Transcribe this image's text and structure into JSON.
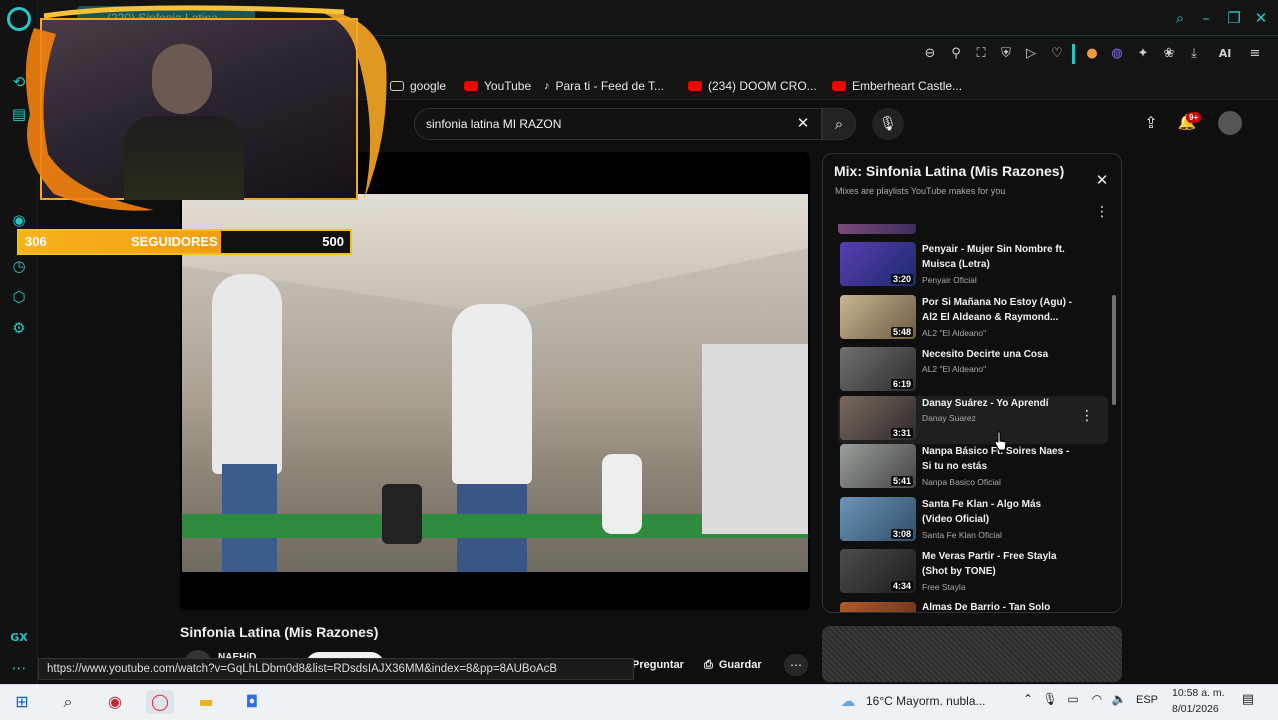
{
  "browser": {
    "active_tab": "(220) Sinfonia Latina - ...",
    "bookmarks": [
      {
        "label": "google",
        "color": "#9aa0a6"
      },
      {
        "label": "YouTube",
        "color": "#ff0000"
      },
      {
        "label": "Para ti - Feed de T...",
        "color": "#ffffff"
      },
      {
        "label": "(234) DOOM CRO...",
        "color": "#ff0000"
      },
      {
        "label": "Emberheart Castle...",
        "color": "#ff0000"
      }
    ],
    "status_url": "https://www.youtube.com/watch?v=GqLhLDbm0d8&list=RDsdsIAJX36MM&index=8&pp=8AUBoAcB",
    "toolbar_ai": "AI",
    "sidebar_bottom": "GX"
  },
  "youtube": {
    "search_query": "sinfonia latina MI RAZON",
    "notifications_badge": "9+",
    "video_title": "Sinfonia Latina (Mis Razones)",
    "channel_partial": "NAEHiD",
    "actions": {
      "ask": "Preguntar",
      "save": "Guardar"
    }
  },
  "stream_overlay": {
    "followers_current": "306",
    "followers_label": "SEGUIDORES",
    "followers_goal": "500",
    "progress_fraction": 0.61
  },
  "playlist": {
    "title": "Mix: Sinfonia Latina (Mis Razones)",
    "subtitle": "Mixes are playlists YouTube makes for you",
    "items": [
      {
        "title": "Penyair - Mujer Sin Nombre ft. Muisca (Letra)",
        "channel": "Penyair Oficial",
        "duration": "3:20"
      },
      {
        "title": "Por Si Mañana No Estoy (Agu) - Al2 El Aldeano & Raymond...",
        "channel": "AL2 \"El Aldeano\"",
        "duration": "5:48"
      },
      {
        "title": "Necesito Decirte una Cosa",
        "channel": "AL2 \"El Aldeano\"",
        "duration": "6:19"
      },
      {
        "title": "Danay Suárez - Yo Aprendí",
        "channel": "Danay Suarez",
        "duration": "3:31"
      },
      {
        "title": "Nanpa Básico Ft. Soires Naes - Si tu no estás",
        "channel": "Nanpa Basico Oficial",
        "duration": "5:41"
      },
      {
        "title": "Santa Fe Klan - Algo Más (Video Oficial)",
        "channel": "Santa Fe Klan Oficial",
        "duration": "3:08"
      },
      {
        "title": "Me Veras Partir - Free Stayla (Shot by TONE)",
        "channel": "Free Stayla",
        "duration": "4:34"
      },
      {
        "title": "Almas De Barrio - Tan Solo",
        "channel": "",
        "duration": ""
      }
    ]
  },
  "taskbar": {
    "weather": "16°C  Mayorm. nubla...",
    "lang": "ESP",
    "time": "10:58 a. m.",
    "date": "8/01/2026"
  }
}
